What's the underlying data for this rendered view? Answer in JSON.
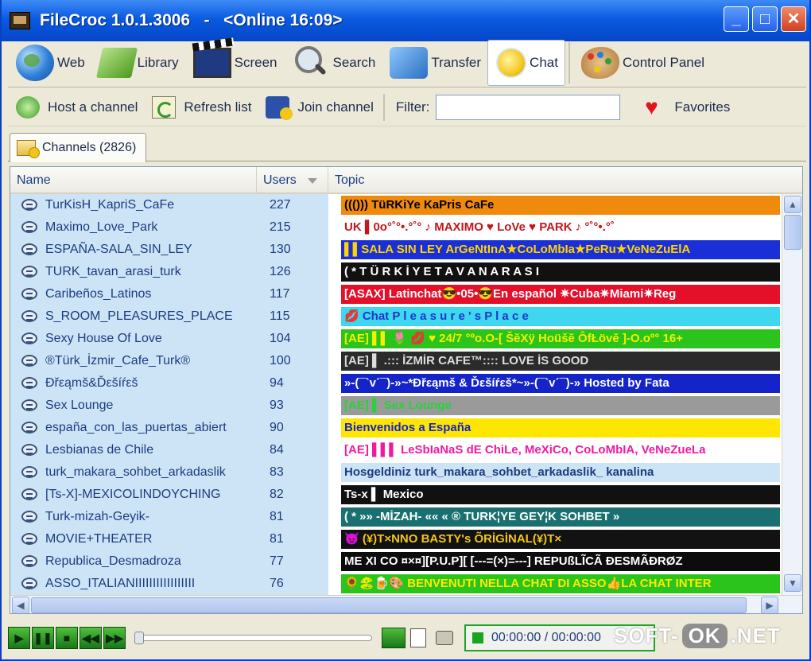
{
  "window": {
    "title": "FileCroc 1.0.1.3006   -   <Online 16:09>",
    "controls": {
      "minimize": "_",
      "maximize": "□",
      "close": "✕"
    }
  },
  "toolbar": {
    "items": [
      {
        "label": "Web",
        "icon": "globe-icon"
      },
      {
        "label": "Library",
        "icon": "library-icon"
      },
      {
        "label": "Screen",
        "icon": "clapperboard-icon"
      },
      {
        "label": "Search",
        "icon": "magnifier-icon"
      },
      {
        "label": "Transfer",
        "icon": "transfer-icon"
      },
      {
        "label": "Chat",
        "icon": "smiley-chat-icon",
        "active": true
      },
      {
        "label": "Control Panel",
        "icon": "palette-icon"
      }
    ]
  },
  "toolbar2": {
    "host_label": "Host a channel",
    "refresh_label": "Refresh list",
    "join_label": "Join channel",
    "filter_label": "Filter:",
    "filter_value": "",
    "favorites_label": "Favorites"
  },
  "tabs": {
    "channels_label": "Channels (2826)"
  },
  "list": {
    "columns": {
      "name": "Name",
      "users": "Users",
      "topic": "Topic"
    },
    "rows": [
      {
        "name": "TurKisH_KapriS_CaFe",
        "users": "227",
        "topic": "((()))          TüRKiYe  KaPris  CaFe",
        "bg": "#f08a0c",
        "fg": "#000000"
      },
      {
        "name": "Maximo_Love_Park",
        "users": "215",
        "topic": "UK ▌0o°˚°•.°˚° ♪ MAXIMO ♥ LoVe ♥ PARK ♪ °˚°•.°˚",
        "bg": "#ffffff",
        "fg": "#c4161c"
      },
      {
        "name": "ESPAÑA-SALA_SIN_LEY",
        "users": "130",
        "topic": "▌▌SALA SIN LEY ArGeNtInA★CoLoMbIa★PeRu★VeNeZuElA",
        "bg": "#1a2fd6",
        "fg": "#ffd400"
      },
      {
        "name": "TURK_tavan_arasi_turk",
        "users": "126",
        "topic": "( *   T Ü R K İ Y E      T A V A N A R A S I",
        "bg": "#111111",
        "fg": "#ffffff"
      },
      {
        "name": "Caribeños_Latinos",
        "users": "117",
        "topic": "[ASAX] Latinchat😎•05•😎En español ✷Cuba✷Miami✷Reg",
        "bg": "#e4102a",
        "fg": "#ffffff"
      },
      {
        "name": "S_ROOM_PLEASURES_PLACE",
        "users": "115",
        "topic": "💋 Chat          P l e a s u r e ' s   P l a c e",
        "bg": "#3fd6f0",
        "fg": "#1b38c8"
      },
      {
        "name": "Sexy House Of Love",
        "users": "104",
        "topic": "[AE] ▌▌ 🌷  💋  ♥  24/7 °ºo.O-[ ŠĕXÿ Hoüšĕ ÔfŁövĕ ]-O.oº° 16+",
        "bg": "#2ac41c",
        "fg": "#f4f000"
      },
      {
        "name": "®Türk_İzmir_Cafe_Turk®",
        "users": "100",
        "topic": "[AE] ▌ .::: İZMİR CAFE™::::       LOVE İS GOOD",
        "bg": "#2b2b2b",
        "fg": "#dddddd"
      },
      {
        "name": "Ðřεąmš&Ďεšíŕεš",
        "users": "94",
        "topic": "»-(¯`v´¯)-»~*Ðřεąmš & Ďεšíŕεš*~»-(¯`v´¯)-» Hosted by Fata",
        "bg": "#1424c8",
        "fg": "#ffffff"
      },
      {
        "name": "Sex Lounge",
        "users": "93",
        "topic": "[AE] ▌                                                                  Sex Lounge",
        "bg": "#9a9a9a",
        "fg": "#2ad23a"
      },
      {
        "name": "españa_con_las_puertas_abiert",
        "users": "90",
        "topic": "                      Bienvenidos a España",
        "bg": "#ffe600",
        "fg": "#1424c8"
      },
      {
        "name": "Lesbianas de Chile",
        "users": "84",
        "topic": "[AE] ▌▌▌ LeSbIaNaS dE ChiLe, MeXiCo, CoLoMbIA, VeNeZueLa",
        "bg": "#ffffff",
        "fg": "#f01aa0"
      },
      {
        "name": "turk_makara_sohbet_arkadaslik",
        "users": "83",
        "topic": "Hosgeldiniz turk_makara_sohbet_arkadaslik_ kanalina",
        "bg": "#cde4f6",
        "fg": "#1c3c80"
      },
      {
        "name": "[Ts-X]-MEXICOLINDOYCHING",
        "users": "82",
        "topic": "Ts-x ▌                                                     Mexico",
        "bg": "#111111",
        "fg": "#ffffff"
      },
      {
        "name": "Turk-mizah-Geyik-",
        "users": "81",
        "topic": "( *  »» -MİZAH- ««   « ® TURK¦YE GEY¦K SOHBET »",
        "bg": "#1a7070",
        "fg": "#ffffff"
      },
      {
        "name": "MOVIE+THEATER",
        "users": "81",
        "topic": "😈              (¥)T×NNO BASTY's ÕRİGİNAL(¥)T×",
        "bg": "#121212",
        "fg": "#f2c516"
      },
      {
        "name": "Republica_Desmadroza",
        "users": "77",
        "topic": "ME XI CO ¤×¤][P.U.P][ [---=(×)=---] REPUßLĨCÃ ÐESMÃÐRØZ",
        "bg": "#0c0c0c",
        "fg": "#ffffff"
      },
      {
        "name": "ASSO_ITALIANIIIIIIIIIIIIIIIII",
        "users": "76",
        "topic": "🌻🏖🍺🎨 BENVENUTI NELLA CHAT DI ASSO👍LA CHAT INTER",
        "bg": "#2ac41c",
        "fg": "#ffea00"
      }
    ]
  },
  "player": {
    "buttons": [
      "▶",
      "❚❚",
      "■",
      "◀◀",
      "▶▶"
    ],
    "time": "00:00:00 / 00:00:00"
  },
  "watermark": {
    "left": "SOFT-",
    "middle": "OK",
    "right": ".NET"
  },
  "colors": {
    "titlebar": "#0a5be0",
    "row_highlight": "#cde4f6",
    "accent_green": "#1ea42a"
  }
}
